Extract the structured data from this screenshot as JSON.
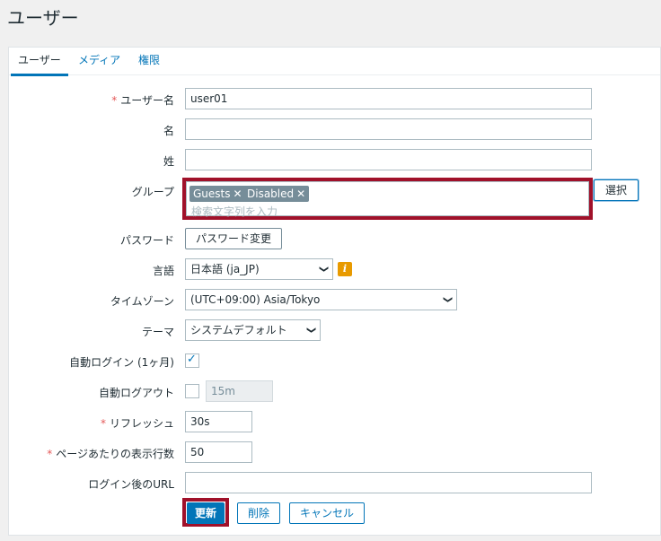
{
  "page_title": "ユーザー",
  "tabs": [
    {
      "label": "ユーザー",
      "active": true
    },
    {
      "label": "メディア",
      "active": false
    },
    {
      "label": "権限",
      "active": false
    }
  ],
  "form": {
    "username": {
      "label": "ユーザー名",
      "required": true,
      "value": "user01"
    },
    "name": {
      "label": "名",
      "value": ""
    },
    "surname": {
      "label": "姓",
      "value": ""
    },
    "groups": {
      "label": "グループ",
      "chips": [
        "Guests",
        "Disabled"
      ],
      "placeholder": "検索文字列を入力",
      "select_button": "選択"
    },
    "password": {
      "label": "パスワード",
      "button": "パスワード変更"
    },
    "language": {
      "label": "言語",
      "value": "日本語 (ja_JP)",
      "info_icon": "info-icon"
    },
    "timezone": {
      "label": "タイムゾーン",
      "value": "(UTC+09:00) Asia/Tokyo"
    },
    "theme": {
      "label": "テーマ",
      "value": "システムデフォルト"
    },
    "autologin": {
      "label": "自動ログイン (1ヶ月)",
      "checked": true
    },
    "autologout": {
      "label": "自動ログアウト",
      "checked": false,
      "value": "15m"
    },
    "refresh": {
      "label": "リフレッシュ",
      "required": true,
      "value": "30s"
    },
    "rows_per_page": {
      "label": "ページあたりの表示行数",
      "required": true,
      "value": "50"
    },
    "url": {
      "label": "ログイン後のURL",
      "value": ""
    }
  },
  "buttons": {
    "update": "更新",
    "delete": "削除",
    "cancel": "キャンセル"
  },
  "colors": {
    "accent": "#0275b8",
    "highlight": "#a0112a",
    "required": "#e45959"
  }
}
